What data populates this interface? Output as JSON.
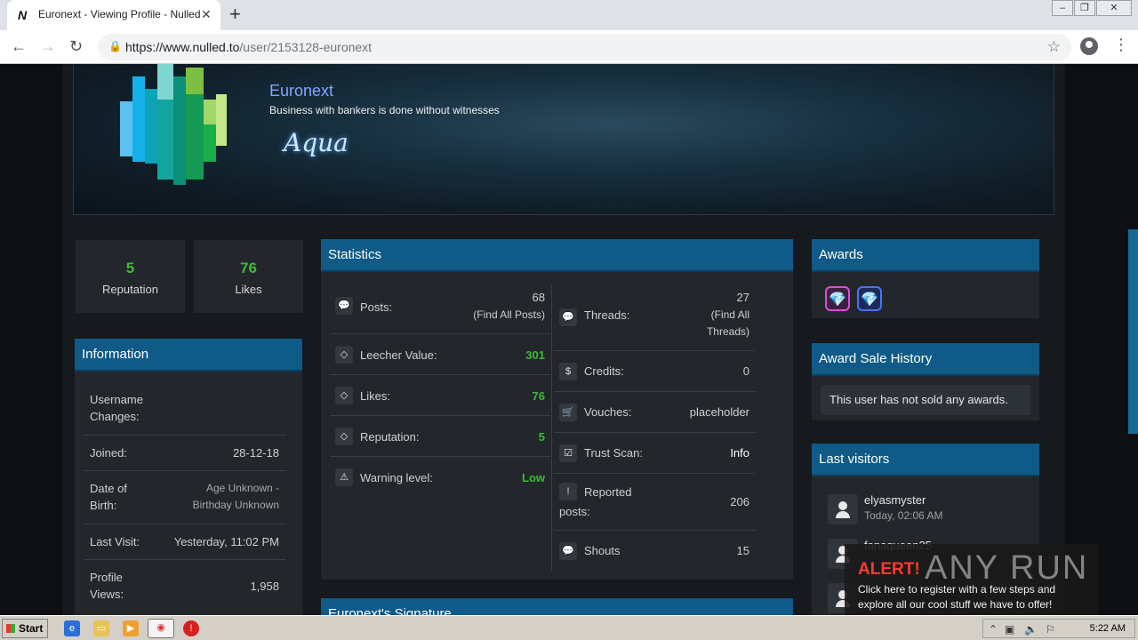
{
  "browser": {
    "tab_title": "Euronext - Viewing Profile - Nulled",
    "tab_favicon": "N",
    "url_host": "https://www.nulled.to",
    "url_path": "/user/2153128-euronext"
  },
  "profile": {
    "username": "Euronext",
    "tagline": "Business with bankers is done without witnesses",
    "badge_text": "Aqua",
    "reputation": {
      "value": "5",
      "label": "Reputation"
    },
    "likes": {
      "value": "76",
      "label": "Likes"
    }
  },
  "information": {
    "title": "Information",
    "rows": [
      {
        "key": "Username Changes:",
        "value": ""
      },
      {
        "key": "Joined:",
        "value": "28-12-18"
      },
      {
        "key": "Date of Birth:",
        "value": "Age Unknown - Birthday Unknown"
      },
      {
        "key": "Last Visit:",
        "value": "Yesterday, 11:02 PM"
      },
      {
        "key": "Profile Views:",
        "value": "1,958"
      }
    ]
  },
  "statistics": {
    "title": "Statistics",
    "left": [
      {
        "icon": "comment-icon",
        "key": "Posts:",
        "value": "68",
        "sub": "(Find All Posts)"
      },
      {
        "icon": "diamond-icon",
        "key": "Leecher Value:",
        "value": "301"
      },
      {
        "icon": "diamond-icon",
        "key": "Likes:",
        "value": "76"
      },
      {
        "icon": "diamond-icon",
        "key": "Reputation:",
        "value": "5"
      },
      {
        "icon": "warning-icon",
        "key": "Warning level:",
        "value": "Low"
      }
    ],
    "right": [
      {
        "icon": "comments-icon",
        "key": "Threads:",
        "value": "27",
        "sub1": "(Find All",
        "sub2": "Threads)"
      },
      {
        "icon": "dollar-icon",
        "key": "Credits:",
        "value": "0"
      },
      {
        "icon": "cart-icon",
        "key": "Vouches:",
        "value": "placeholder"
      },
      {
        "icon": "check-icon",
        "key": "Trust Scan:",
        "value": "Info"
      },
      {
        "icon": "exclamation-icon",
        "key": "Reported posts:",
        "value": "206"
      },
      {
        "icon": "comments-icon",
        "key": "Shouts",
        "value": "15"
      }
    ]
  },
  "signature": {
    "title": "Euronext's Signature"
  },
  "awards": {
    "title": "Awards",
    "items": [
      "pink-diamond-icon",
      "blue-diamond-icon"
    ]
  },
  "award_sale": {
    "title": "Award Sale History",
    "message": "This user has not sold any awards."
  },
  "last_visitors": {
    "title": "Last visitors",
    "items": [
      {
        "name": "elyasmyster",
        "time": "Today, 02:06 AM"
      },
      {
        "name": "fanaqueen25",
        "time": ""
      },
      {
        "name": "",
        "time": ""
      }
    ]
  },
  "alert": {
    "title": "ALERT!",
    "logo": "ANY RUN",
    "text": "Click here to register with a few steps and explore all our cool stuff we have to offer!"
  },
  "taskbar": {
    "start": "Start",
    "clock": "5:22 AM"
  },
  "colors": {
    "accent": "#0f5a86",
    "green": "#3bbb35",
    "username": "#7fa7ff"
  }
}
